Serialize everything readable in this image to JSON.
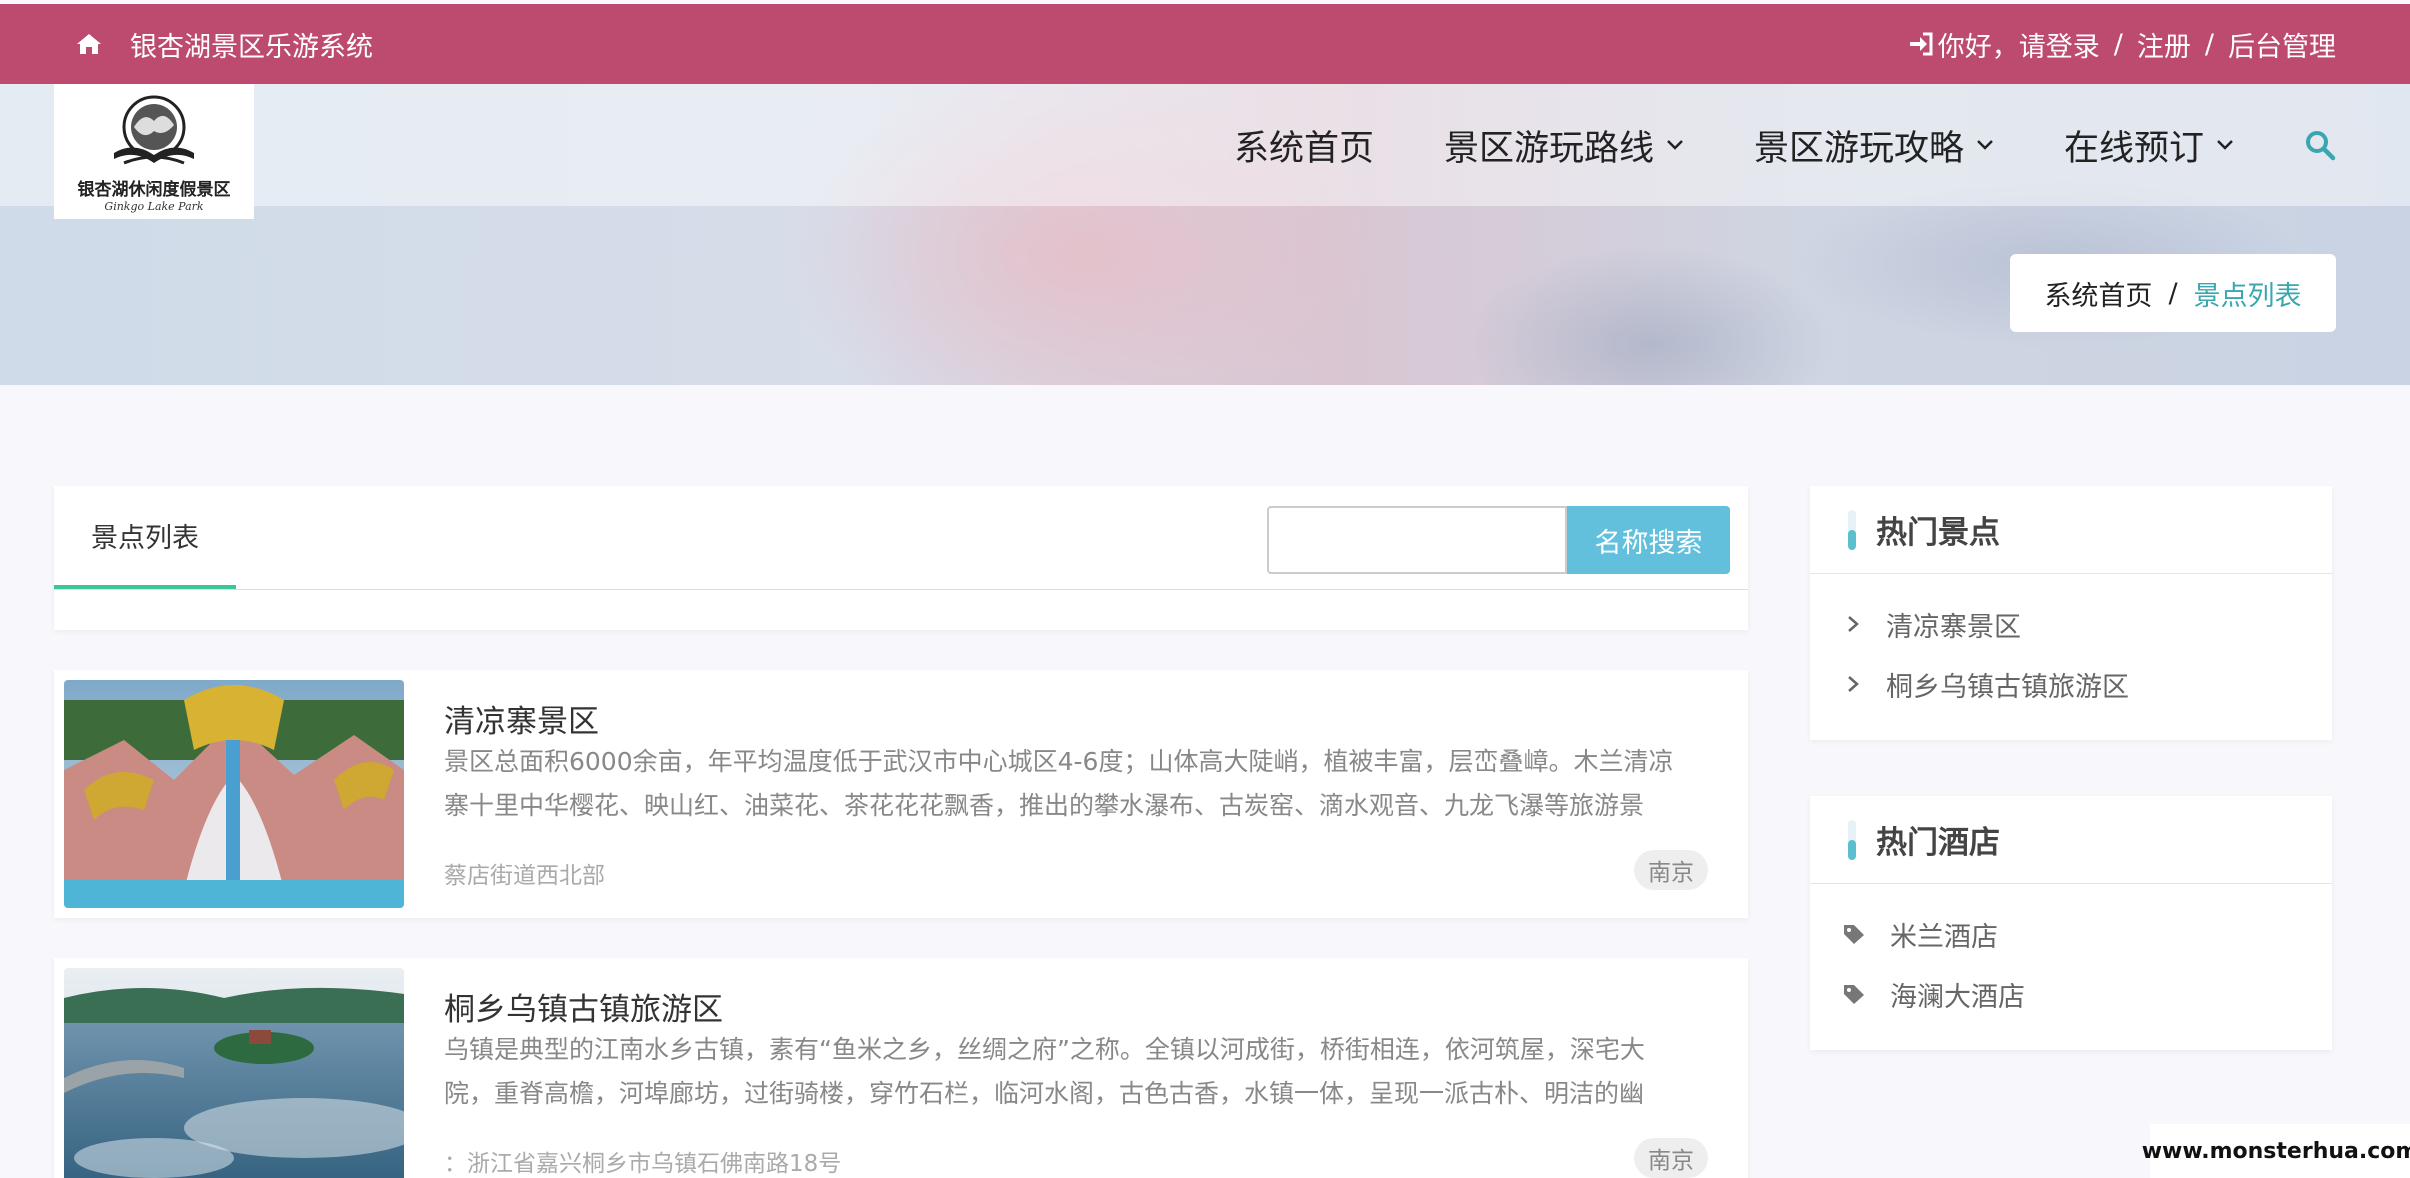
{
  "topbar": {
    "site_title": "银杏湖景区乐游系统",
    "greeting": "你好，请登录",
    "sep1": "/",
    "register": "注册",
    "sep2": "/",
    "admin": "后台管理"
  },
  "logo": {
    "name": "银杏湖休闲度假景区",
    "subtitle": "Ginkgo Lake Park"
  },
  "nav": {
    "items": [
      {
        "label": "系统首页",
        "has_dropdown": false
      },
      {
        "label": "景区游玩路线",
        "has_dropdown": true
      },
      {
        "label": "景区游玩攻略",
        "has_dropdown": true
      },
      {
        "label": "在线预订",
        "has_dropdown": true
      }
    ],
    "search_icon": "search-icon"
  },
  "breadcrumb": {
    "home": "系统首页",
    "sep": "/",
    "current": "景点列表"
  },
  "list": {
    "tab_label": "景点列表",
    "search_placeholder": "",
    "search_button": "名称搜索",
    "items": [
      {
        "title": "清凉寨景区",
        "desc": "景区总面积6000余亩，年平均温度低于武汉市中心城区4-6度；山体高大陡峭，植被丰富，层峦叠嶂。木兰清凉寨十里中华樱花、映山红、油菜花、茶花花花飘香，推出的攀水瀑布、古炭窑、滴水观音、九龙飞瀑等旅游景",
        "address": "蔡店街道西北部",
        "tag": "南京"
      },
      {
        "title": "桐乡乌镇古镇旅游区",
        "desc": "乌镇是典型的江南水乡古镇，素有“鱼米之乡，丝绸之府”之称。全镇以河成街，桥街相连，依河筑屋，深宅大院，重脊高檐，河埠廊坊，过街骑楼，穿竹石栏，临河水阁，古色古香，水镇一体，呈现一派古朴、明洁的幽",
        "address": "：浙江省嘉兴桐乡市乌镇石佛南路18号",
        "tag": "南京"
      }
    ]
  },
  "sidebar": {
    "hot_spots": {
      "title": "热门景点",
      "items": [
        "清凉寨景区",
        "桐乡乌镇古镇旅游区"
      ]
    },
    "hot_hotels": {
      "title": "热门酒店",
      "items": [
        "米兰酒店",
        "海澜大酒店"
      ]
    }
  },
  "watermark": "www.monsterhua.com",
  "colors": {
    "topbar": "#bd4b70",
    "accent_teal": "#3aa6b0",
    "tab_underline": "#3cc59a",
    "search_button": "#63c0dc"
  }
}
